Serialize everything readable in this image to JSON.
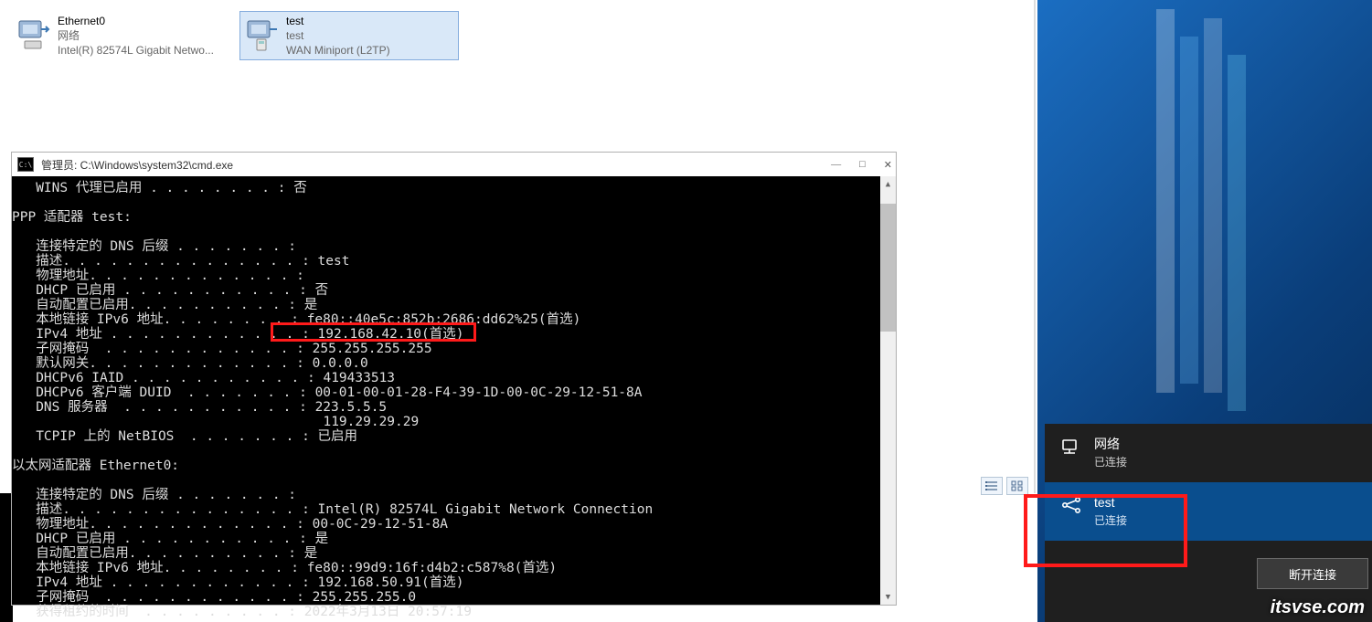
{
  "adapters": [
    {
      "name": "Ethernet0",
      "line2": "网络",
      "line3": "Intel(R) 82574L Gigabit Netwo...",
      "selected": false
    },
    {
      "name": "test",
      "line2": "test",
      "line3": "WAN Miniport (L2TP)",
      "selected": true
    }
  ],
  "cmd": {
    "title": "管理员: C:\\Windows\\system32\\cmd.exe",
    "icon_text": "C:\\",
    "lines": [
      "   WINS 代理已启用 . . . . . . . . : 否",
      "",
      "PPP 适配器 test:",
      "",
      "   连接特定的 DNS 后缀 . . . . . . . :",
      "   描述. . . . . . . . . . . . . . . : test",
      "   物理地址. . . . . . . . . . . . . :",
      "   DHCP 已启用 . . . . . . . . . . . : 否",
      "   自动配置已启用. . . . . . . . . . : 是",
      "   本地链接 IPv6 地址. . . . . . . . : fe80::40e5c:852b:2686:dd62%25(首选)",
      "   IPv4 地址 . . . . . . . . . . . . : 192.168.42.10(首选)",
      "   子网掩码  . . . . . . . . . . . . : 255.255.255.255",
      "   默认网关. . . . . . . . . . . . . : 0.0.0.0",
      "   DHCPv6 IAID . . . . . . . . . . . : 419433513",
      "   DHCPv6 客户端 DUID  . . . . . . . : 00-01-00-01-28-F4-39-1D-00-0C-29-12-51-8A",
      "   DNS 服务器  . . . . . . . . . . . : 223.5.5.5",
      "                                       119.29.29.29",
      "   TCPIP 上的 NetBIOS  . . . . . . . : 已启用",
      "",
      "以太网适配器 Ethernet0:",
      "",
      "   连接特定的 DNS 后缀 . . . . . . . :",
      "   描述. . . . . . . . . . . . . . . : Intel(R) 82574L Gigabit Network Connection",
      "   物理地址. . . . . . . . . . . . . : 00-0C-29-12-51-8A",
      "   DHCP 已启用 . . . . . . . . . . . : 是",
      "   自动配置已启用. . . . . . . . . . : 是",
      "   本地链接 IPv6 地址. . . . . . . . : fe80::99d9:16f:d4b2:c587%8(首选)",
      "   IPv4 地址 . . . . . . . . . . . . : 192.168.50.91(首选)",
      "   子网掩码  . . . . . . . . . . . . : 255.255.255.0",
      "   获得租约的时间  . . . . . . . . . : 2022年3月13日 20:57:19"
    ],
    "winbtns": {
      "min": "—",
      "max": "□",
      "close": "✕"
    }
  },
  "netpanel": {
    "items": [
      {
        "name": "网络",
        "status": "已连接",
        "kind": "ethernet"
      },
      {
        "name": "test",
        "status": "已连接",
        "kind": "vpn"
      }
    ],
    "disconnect_label": "断开连接"
  },
  "watermark": "itsvse.com"
}
